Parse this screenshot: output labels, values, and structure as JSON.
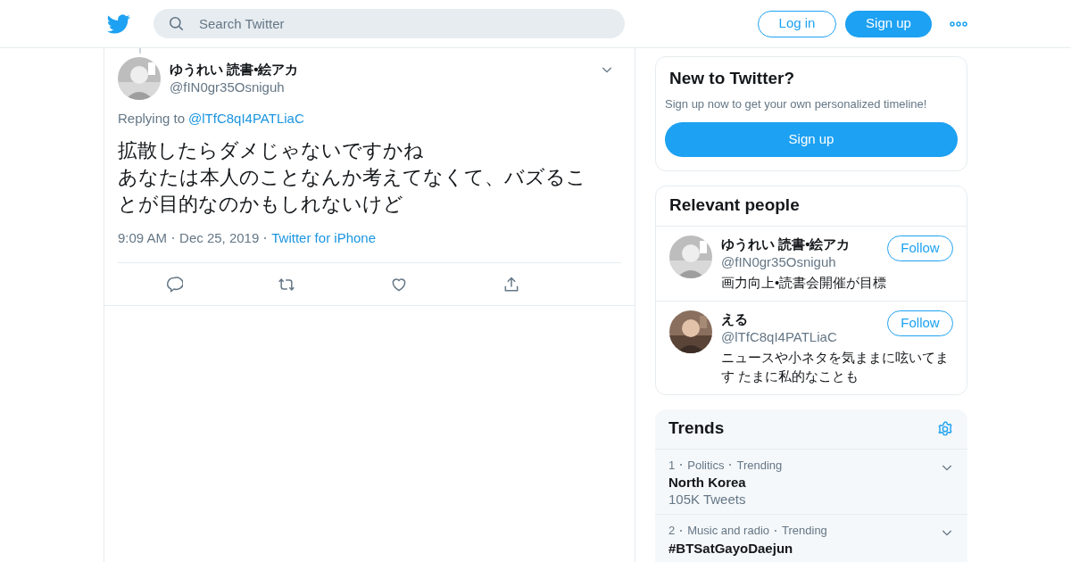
{
  "header": {
    "search": {
      "placeholder": "Search Twitter"
    },
    "login": "Log in",
    "signup": "Sign up"
  },
  "tweet": {
    "name": "ゆうれい 読書•絵アカ",
    "handle": "@fIN0gr35Osniguh",
    "replying_label": "Replying to",
    "replying_to": "@lTfC8qI4PATLiaC",
    "lines": [
      "拡散したらダメじゃないですかね",
      "あなたは本人のことなんか考えてなくて、バズることが目的なのかもしれないけど"
    ],
    "time": "9:09 AM",
    "date": "Dec 25, 2019",
    "source": "Twitter for iPhone"
  },
  "new_to_twitter": {
    "title": "New to Twitter?",
    "subtitle": "Sign up now to get your own personalized timeline!",
    "button": "Sign up"
  },
  "relevant_people": {
    "title": "Relevant people",
    "people": [
      {
        "name": "ゆうれい 読書•絵アカ",
        "handle": "@fIN0gr35Osniguh",
        "bio": "画力向上•読書会開催が目標",
        "button": "Follow"
      },
      {
        "name": "える",
        "handle": "@lTfC8qI4PATLiaC",
        "bio": "ニュースや小ネタを気ままに呟いてます たまに私的なことも",
        "button": "Follow"
      }
    ]
  },
  "trends": {
    "title": "Trends",
    "items": [
      {
        "rank": "1",
        "category": "Politics",
        "status": "Trending",
        "name": "North Korea",
        "count": "105K Tweets"
      },
      {
        "rank": "2",
        "category": "Music and radio",
        "status": "Trending",
        "name": "#BTSatGayoDaejun"
      }
    ]
  }
}
